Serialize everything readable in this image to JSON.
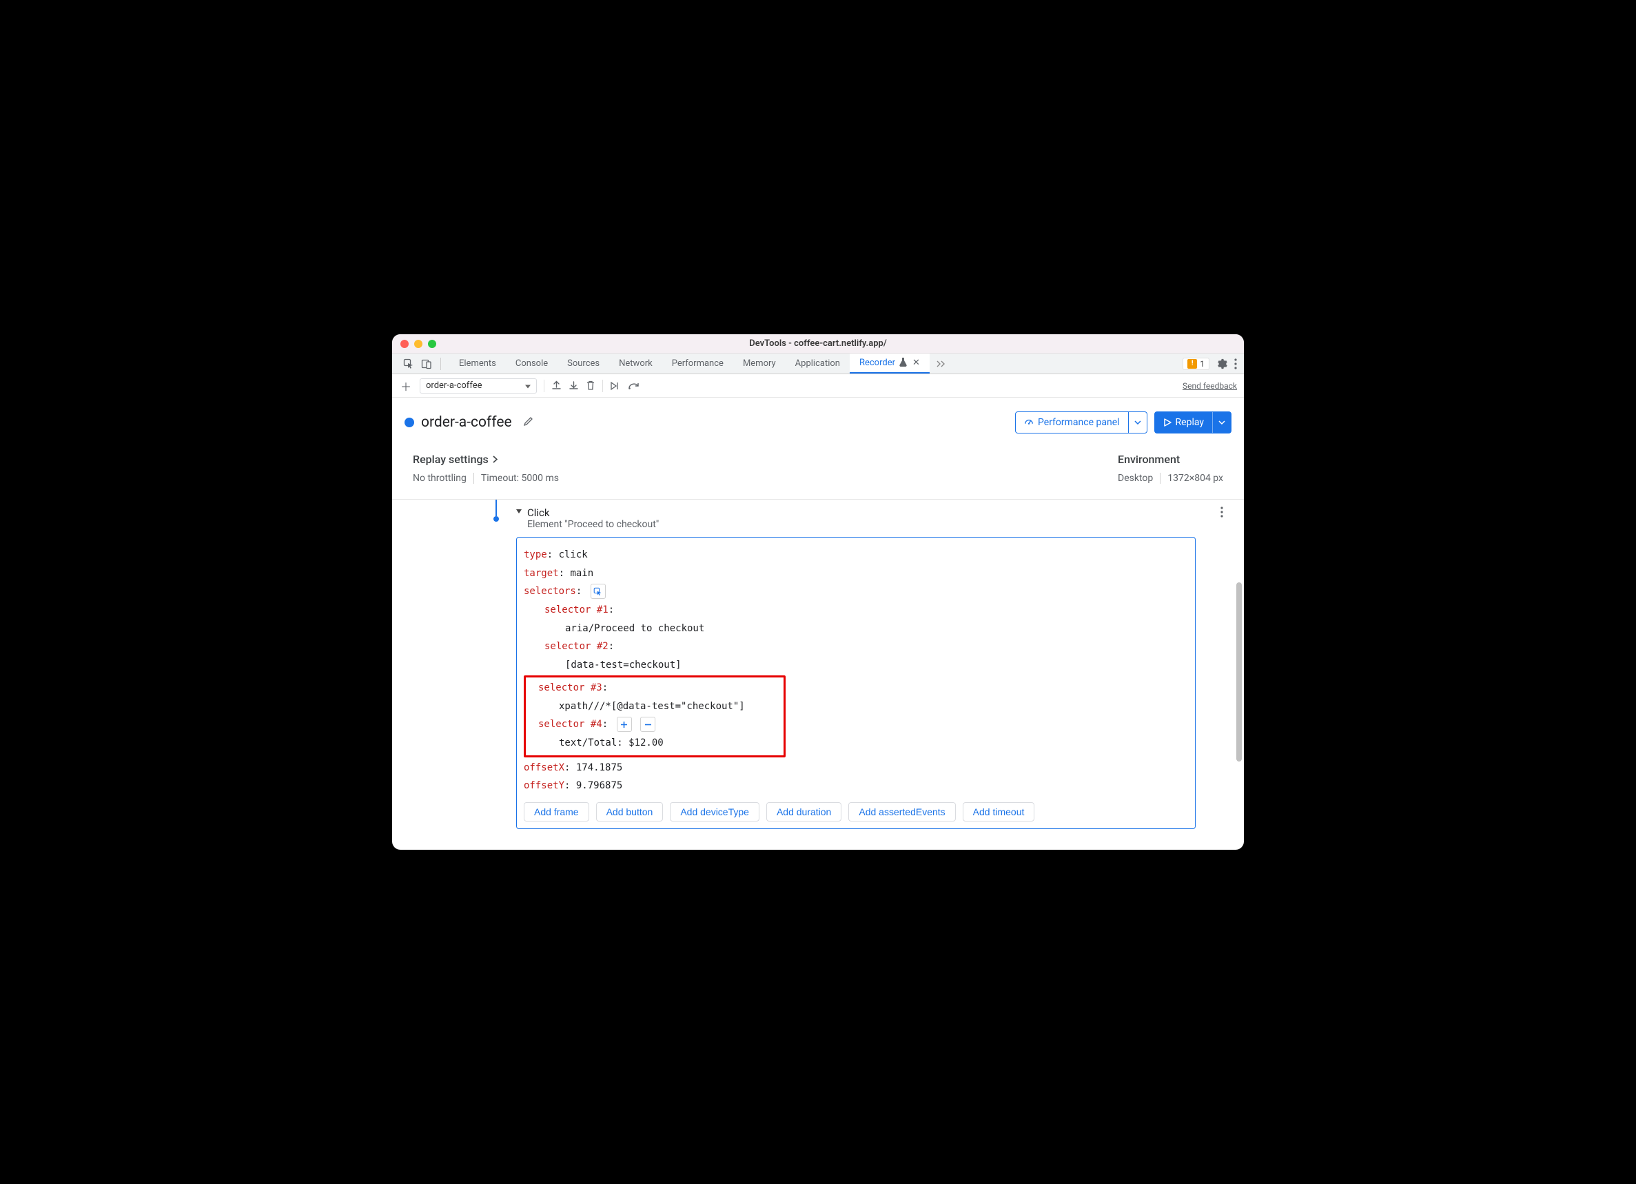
{
  "titlebar": "DevTools - coffee-cart.netlify.app/",
  "tabs": {
    "items": [
      "Elements",
      "Console",
      "Sources",
      "Network",
      "Performance",
      "Memory",
      "Application",
      "Recorder"
    ],
    "activeIndex": 7,
    "issuesCount": "1"
  },
  "recToolbar": {
    "recordingName": "order-a-coffee",
    "feedback": "Send feedback"
  },
  "recHeader": {
    "title": "order-a-coffee",
    "perfButton": "Performance panel",
    "replayButton": "Replay"
  },
  "settings": {
    "replayTitle": "Replay settings",
    "throttling": "No throttling",
    "timeout": "Timeout: 5000 ms",
    "envTitle": "Environment",
    "device": "Desktop",
    "dimensions": "1372×804 px"
  },
  "step": {
    "title": "Click",
    "subtitle": "Element \"Proceed to checkout\"",
    "details": {
      "typeKey": "type",
      "typeVal": "click",
      "targetKey": "target",
      "targetVal": "main",
      "selectorsKey": "selectors",
      "sel1Key": "selector #1",
      "sel1Val": "aria/Proceed to checkout",
      "sel2Key": "selector #2",
      "sel2Val": "[data-test=checkout]",
      "sel3Key": "selector #3",
      "sel3Val": "xpath///*[@data-test=\"checkout\"]",
      "sel4Key": "selector #4",
      "sel4Val": "text/Total: $12.00",
      "offXKey": "offsetX",
      "offXVal": "174.1875",
      "offYKey": "offsetY",
      "offYVal": "9.796875"
    },
    "addButtons": [
      "Add frame",
      "Add button",
      "Add deviceType",
      "Add duration",
      "Add assertedEvents",
      "Add timeout"
    ]
  }
}
